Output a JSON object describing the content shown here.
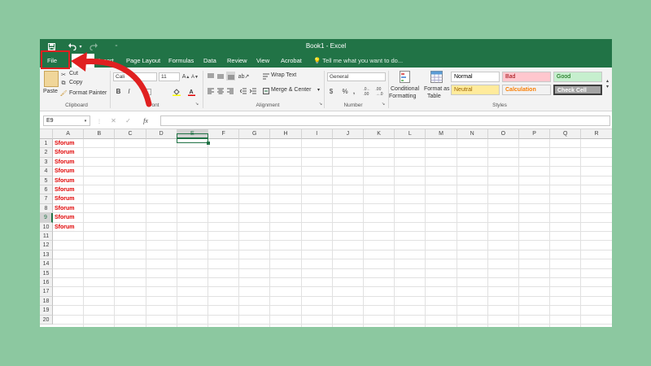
{
  "window": {
    "title": "Book1 - Excel"
  },
  "quick_access": [
    "save-icon",
    "undo-icon",
    "redo-icon",
    "customize-icon"
  ],
  "tabs": [
    {
      "label": "File"
    },
    {
      "label": "Home"
    },
    {
      "label": "Insert"
    },
    {
      "label": "Page Layout"
    },
    {
      "label": "Formulas"
    },
    {
      "label": "Data"
    },
    {
      "label": "Review"
    },
    {
      "label": "View"
    },
    {
      "label": "Acrobat"
    }
  ],
  "tell_me": "Tell me what you want to do...",
  "ribbon": {
    "clipboard": {
      "paste": "Paste",
      "cut": "Cut",
      "copy": "Copy",
      "format_painter": "Format Painter",
      "label": "Clipboard"
    },
    "font": {
      "name": "Cali",
      "size": "11",
      "bold": "B",
      "italic": "I",
      "label": "Font"
    },
    "alignment": {
      "wrap_text": "Wrap Text",
      "merge_center": "Merge & Center",
      "label": "Alignment"
    },
    "number": {
      "format": "General",
      "currency": "$",
      "percent": "%",
      "comma": ",",
      "label": "Number"
    },
    "styles": {
      "conditional": "Conditional",
      "formatting": "Formatting",
      "format_as": "Format as",
      "table": "Table",
      "label": "Styles",
      "cells": [
        {
          "label": "Normal",
          "bg": "#ffffff",
          "color": "#000000"
        },
        {
          "label": "Bad",
          "bg": "#ffc7ce",
          "color": "#9c0006"
        },
        {
          "label": "Good",
          "bg": "#c6efce",
          "color": "#006100"
        },
        {
          "label": "Neutral",
          "bg": "#ffeb9c",
          "color": "#9c6500"
        },
        {
          "label": "Calculation",
          "bg": "#f2f2f2",
          "color": "#fa7d00"
        },
        {
          "label": "Check Cell",
          "bg": "#a5a5a5",
          "color": "#ffffff"
        }
      ]
    }
  },
  "formula_bar": {
    "name_box": "E9",
    "fx": "fx",
    "value": ""
  },
  "columns": [
    "A",
    "B",
    "C",
    "D",
    "E",
    "F",
    "G",
    "H",
    "I",
    "J",
    "K",
    "L",
    "M",
    "N",
    "O",
    "P",
    "Q",
    "R"
  ],
  "rows": [
    "1",
    "2",
    "3",
    "4",
    "5",
    "6",
    "7",
    "8",
    "9",
    "10",
    "11",
    "12",
    "13",
    "14",
    "15",
    "16",
    "17",
    "18",
    "19",
    "20"
  ],
  "column_a_values": [
    "Sforum",
    "Sforum",
    "Sforum",
    "Sforum",
    "Sforum",
    "Sforum",
    "Sforum",
    "Sforum",
    "Sforum",
    "Sforum"
  ],
  "colors": {
    "excel_green": "#217346",
    "annotation_red": "#e02020",
    "cell_text_red": "#e00000"
  }
}
